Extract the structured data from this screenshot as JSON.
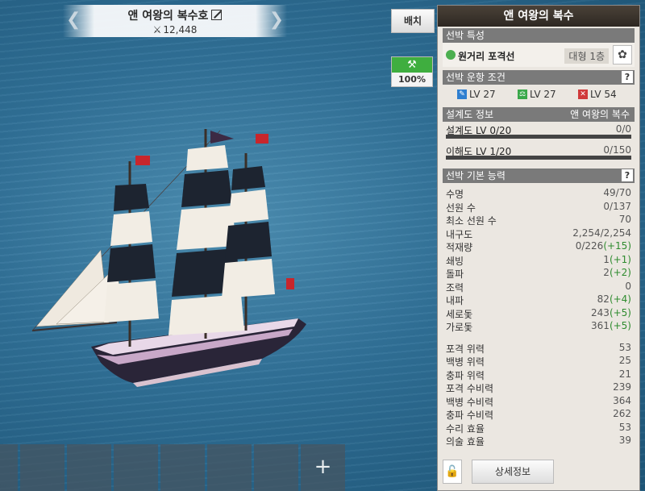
{
  "ship_header": {
    "name": "앤 여왕의 복수호",
    "combat_power": "12,448"
  },
  "buttons": {
    "deploy": "배치",
    "durability_pct": "100%",
    "details": "상세정보",
    "add_slot": "+"
  },
  "panel": {
    "title": "앤 여왕의 복수",
    "trait_section": "선박 특성",
    "trait_name": "원거리 포격선",
    "size": "대형 1층",
    "requirements_section": "선박 운항 조건",
    "requirements": [
      {
        "level": "LV 27",
        "color": "#2f7fd0"
      },
      {
        "level": "LV 27",
        "color": "#3aa84a"
      },
      {
        "level": "LV 54",
        "color": "#d03a3a"
      }
    ],
    "blueprint_section": "설계도 정보",
    "blueprint_name": "앤 여왕의 복수",
    "blueprint_level": "설계도 LV 0/20",
    "blueprint_value": "0/0",
    "understanding_level": "이해도 LV 1/20",
    "understanding_value": "0/150",
    "stats_section": "선박 기본 능력",
    "help": "?"
  },
  "stats": [
    {
      "k": "수명",
      "v": "49/70",
      "b": ""
    },
    {
      "k": "선원 수",
      "v": "0/137",
      "b": ""
    },
    {
      "k": "최소 선원 수",
      "v": "70",
      "b": ""
    },
    {
      "k": "내구도",
      "v": "2,254/2,254",
      "b": ""
    },
    {
      "k": "적재량",
      "v": "0/226",
      "b": "(+15)"
    },
    {
      "k": "쇄빙",
      "v": "1",
      "b": "(+1)"
    },
    {
      "k": "돌파",
      "v": "2",
      "b": "(+2)"
    },
    {
      "k": "조력",
      "v": "0",
      "b": ""
    },
    {
      "k": "내파",
      "v": "82",
      "b": "(+4)"
    },
    {
      "k": "세로돛",
      "v": "243",
      "b": "(+5)"
    },
    {
      "k": "가로돛",
      "v": "361",
      "b": "(+5)"
    }
  ],
  "combat_stats": [
    {
      "k": "포격 위력",
      "v": "53"
    },
    {
      "k": "백병 위력",
      "v": "25"
    },
    {
      "k": "충파 위력",
      "v": "21"
    },
    {
      "k": "포격 수비력",
      "v": "239"
    },
    {
      "k": "백병 수비력",
      "v": "364"
    },
    {
      "k": "충파 수비력",
      "v": "262"
    },
    {
      "k": "수리 효율",
      "v": "53"
    },
    {
      "k": "의술 효율",
      "v": "39"
    }
  ]
}
